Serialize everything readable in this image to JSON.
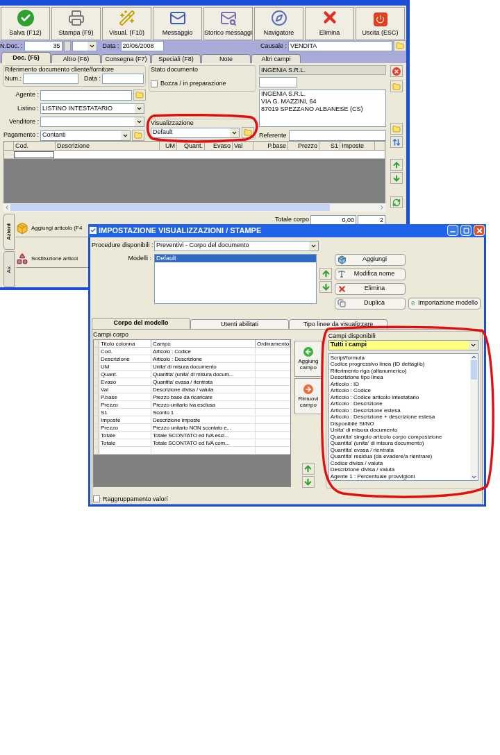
{
  "main_window": {
    "toolbar": [
      {
        "label": "Salva (F12)",
        "kind": "save"
      },
      {
        "label": "Stampa (F9)",
        "kind": "print"
      },
      {
        "label": "Visual. (F10)",
        "kind": "wand"
      },
      {
        "label": "Messaggio",
        "kind": "message"
      },
      {
        "label": "Storico messaggi",
        "kind": "history"
      },
      {
        "label": "Navigatore",
        "kind": "navigator"
      },
      {
        "label": "Elimina",
        "kind": "delete"
      },
      {
        "label": "Uscita (ESC)",
        "kind": "exit"
      }
    ],
    "doc_number": {
      "label": "N.Doc. :",
      "value": "35"
    },
    "date": {
      "label": "Data :",
      "value": "20/06/2008"
    },
    "causale": {
      "label": "Causale :",
      "value": "VENDITA"
    },
    "tabs": [
      {
        "label": "Doc. (F5)",
        "selected": true
      },
      {
        "label": "Altro (F6)",
        "selected": false
      },
      {
        "label": "Consegna (F7)",
        "selected": false
      },
      {
        "label": "Speciali (F8)",
        "selected": false
      },
      {
        "label": "Note",
        "selected": false
      },
      {
        "label": "Altri campi",
        "selected": false
      }
    ],
    "reference": {
      "title": "Riferimento documento cliente/fornitore",
      "num_label": "Num.:",
      "date_label": "Data :"
    },
    "agente": {
      "label": "Agente :"
    },
    "listino": {
      "label": "Listino :",
      "value": "LISTINO INTESTATARIO"
    },
    "venditore": {
      "label": "Venditore :"
    },
    "pagamento": {
      "label": "Pagamento :",
      "value": "Contanti"
    },
    "stato": {
      "title": "Stato documento",
      "draft": {
        "label": "Bozza / in preparazione",
        "checked": false
      }
    },
    "visualizzazione": {
      "title": "Visualizzazione",
      "value": "Default"
    },
    "customer": {
      "name": "INGENIA S.R.L.",
      "address": [
        "INGENIA S.R.L.",
        "VIA G. MAZZINI, 64",
        "87019 SPEZZANO ALBANESE (CS)"
      ]
    },
    "referente": {
      "label": "Referente"
    },
    "grid_columns": [
      "Cod.",
      "Descrizione",
      "UM",
      "Quant.",
      "Evaso",
      "Val",
      "P.base",
      "Prezzo",
      "S1",
      "Imposte"
    ],
    "side_tabs": [
      {
        "label": "Azioni",
        "selected": true
      },
      {
        "label": "Av.",
        "selected": false
      }
    ],
    "actions": [
      {
        "label": "Aggiungi articolo (F4",
        "kind": "add"
      },
      {
        "label": "Sostituzione articol",
        "kind": "replace"
      }
    ],
    "totals": {
      "label": "Totale corpo",
      "value": "0,00",
      "count": "2"
    }
  },
  "dialog": {
    "title": "IMPOSTAZIONE VISUALIZZAZIONI / STAMPE",
    "procedure": {
      "label": "Procedure disponibili :",
      "value": "Preventivi - Corpo del documento"
    },
    "models": {
      "label": "Modelli :",
      "items": [
        {
          "label": "Default",
          "selected": true
        }
      ]
    },
    "buttons": [
      {
        "label": "Aggiungi",
        "kind": "add"
      },
      {
        "label": "Modifica nome",
        "kind": "rename"
      },
      {
        "label": "Elimina",
        "kind": "delete"
      },
      {
        "label": "Duplica",
        "kind": "duplicate"
      }
    ],
    "import_button": "Importazione modello",
    "tabs": [
      {
        "label": "Corpo del modello",
        "selected": true
      },
      {
        "label": "Utenti abilitati",
        "selected": false
      },
      {
        "label": "Tipo linee da visualizzare",
        "selected": false
      }
    ],
    "campi_corpo": {
      "title": "Campi corpo",
      "columns": [
        "Titolo colonna",
        "Campo",
        "Ordinamento"
      ],
      "rows": [
        [
          "Cod.",
          "Articolo : Codice"
        ],
        [
          "Descrizione",
          "Articolo : Descrizione"
        ],
        [
          "UM",
          "Unita' di misura documento"
        ],
        [
          "Quant.",
          "Quantita' (unita' di misura docum..."
        ],
        [
          "Evaso",
          "Quantita' evasa / rientrata"
        ],
        [
          "Val",
          "Descrizione divisa / valuta"
        ],
        [
          "P.base",
          "Prezzo base da ricaricare"
        ],
        [
          "Prezzo",
          "Prezzo unitario iva esclusa"
        ],
        [
          "S1",
          "Sconto 1"
        ],
        [
          "Imposte",
          "Descrizione imposte"
        ],
        [
          "Prezzo",
          "Prezzo unitario NON scontato e..."
        ],
        [
          "Totale",
          "Totale SCONTATO ed IVA escl..."
        ],
        [
          "Totale",
          "Totale SCONTATO ed IVA com..."
        ]
      ]
    },
    "add_field": "Aggiung campo",
    "remove_field": "Rimuovi campo",
    "grouping": {
      "label": "Raggruppamento valori",
      "checked": false
    },
    "campi_disponibili": {
      "title": "Campi disponibili",
      "filter": "Tutti i campi",
      "items": [
        "Script/formula",
        "Codice progressivo linea (ID dettaglio)",
        "Riferimento riga (alfanumerico)",
        "Descrizione tipo linea",
        "Articolo : ID",
        "Articolo : Codice",
        "Articolo : Codice articolo intestatario",
        "Articolo : Descrizione",
        "Articolo : Descrizione estesa",
        "Articolo : Descrizione + descrizione estesa",
        "Disponibile SI/NO",
        "Unita' di misura documento",
        "Quantita' singolo articolo corpo composizione",
        "Quantita' (unita' di misura documento)",
        "Quantita' evasa / rientrata",
        "Quantita' residua (da evadere/a rientrare)",
        "Codice divisa / valuta",
        "Descrizione divisa / valuta",
        "Agente 1 : Percentuale provvigioni"
      ]
    }
  }
}
